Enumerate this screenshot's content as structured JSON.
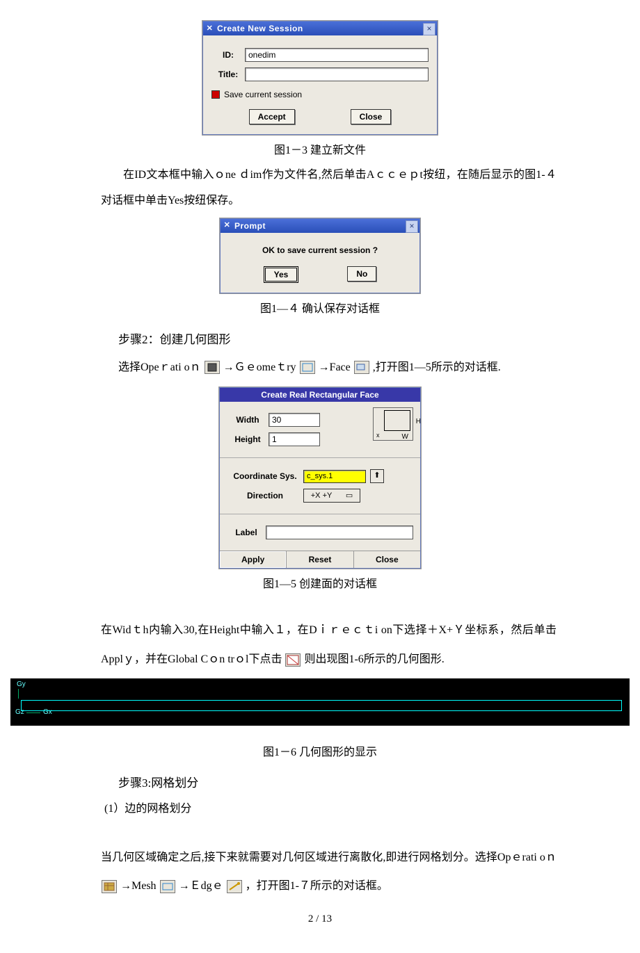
{
  "dlg1": {
    "title": "Create New Session",
    "id_label": "ID:",
    "id_value": "onedim",
    "title_label": "Title:",
    "title_value": "",
    "save_label": "Save current session",
    "accept": "Accept",
    "close": "Close"
  },
  "cap1": "图1－3 建立新文件",
  "para1": "在ID文本框中输入ｏne ｄim作为文件名,然后单击Aｃｃｅｐt按纽，在随后显示的图1-４对话框中单击Yes按纽保存。",
  "dlg2": {
    "title": "Prompt",
    "msg": "OK to save current session ?",
    "yes": "Yes",
    "no": "No"
  },
  "cap2": "图1—４  确认保存对话框",
  "step2": "步骤2：创建几何图形",
  "line2a_1": "选择Opeｒati oｎ",
  "line2a_2": "→Ｇｅomeｔry",
  "line2a_3": "→Face",
  "line2a_4": ",打开图1—5所示的对话框.",
  "dlg3": {
    "title": "Create Real Rectangular Face",
    "width_label": "Width",
    "width_value": "30",
    "height_label": "Height",
    "height_value": "1",
    "diagram": {
      "H": "H",
      "W": "W",
      "x": "x"
    },
    "coord_label": "Coordinate Sys.",
    "coord_value": "c_sys.1",
    "dir_label": "Direction",
    "dir_value": "+X +Y",
    "label_label": "Label",
    "label_value": "",
    "apply": "Apply",
    "reset": "Reset",
    "close": "Close"
  },
  "cap3": "图1—5    创建面的对话框",
  "para3a": "在Widｔh内输入30,在Height中输入１，在Dｉｒｅｃｔi on下选择＋X+Ｙ坐标系，然后单击Applｙ，并在Global Cｏn trｏl下点击",
  "para3a_2": "则出现图1-6所示的几何图形.",
  "geom": {
    "gy": "Gy",
    "gz": "Gz",
    "gx": "Gx"
  },
  "cap4": "图1－6 几何图形的显示",
  "step3": "步骤3:网格划分",
  "sub1": "(1）边的网格划分",
  "para4a": "当几何区域确定之后,接下来就需要对几何区域进行离散化,即进行网格划分。选择Opｅrati oｎ",
  "para4b": "→Mesh",
  "para4c": "→Ｅdgｅ",
  "para4d": "，打开图1-７所示的对话框。",
  "pagenum": "2 / 13"
}
